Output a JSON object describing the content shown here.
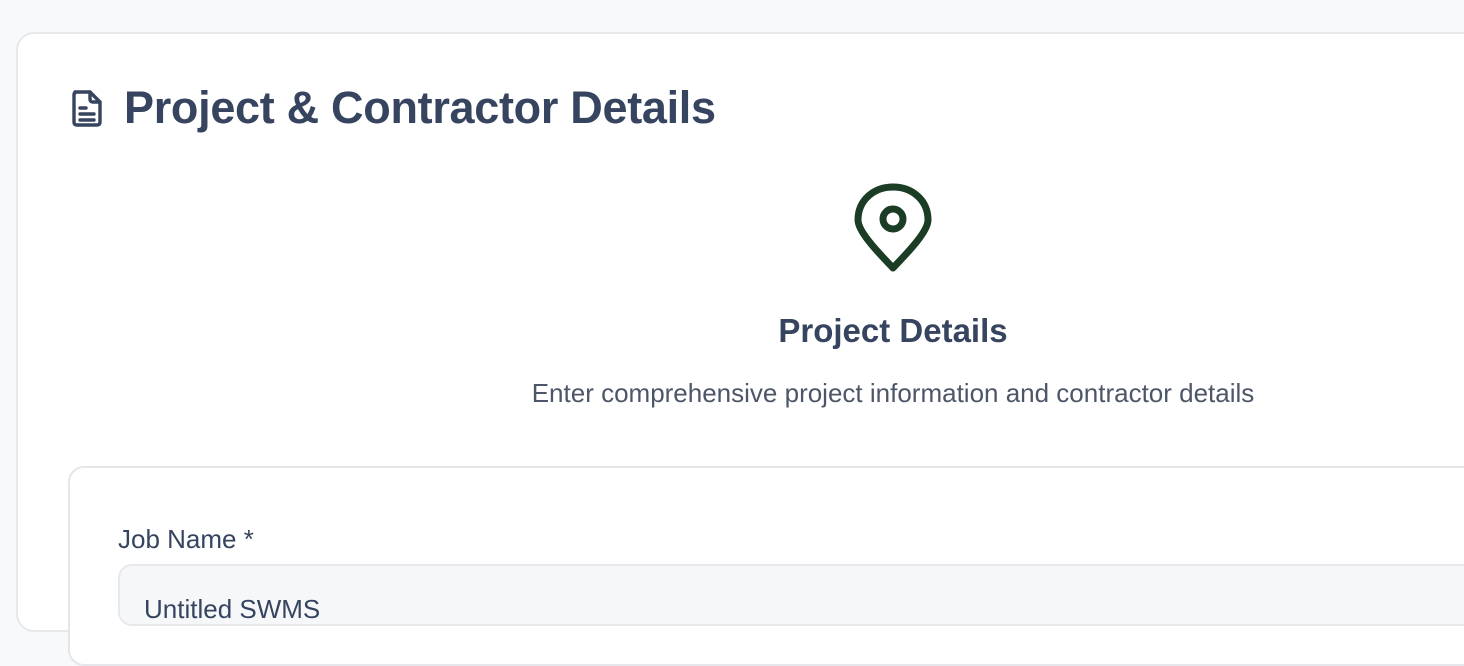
{
  "header": {
    "title": "Project & Contractor Details",
    "icon": "document-icon"
  },
  "hero": {
    "icon": "map-pin-icon",
    "title": "Project Details",
    "subtitle": "Enter comprehensive project information and contractor details"
  },
  "form": {
    "job_name": {
      "label": "Job Name *",
      "value": "Untitled SWMS"
    }
  },
  "colors": {
    "heading": "#36445f",
    "pin_accent": "#1b3d25",
    "background": "#f8f9fb"
  }
}
